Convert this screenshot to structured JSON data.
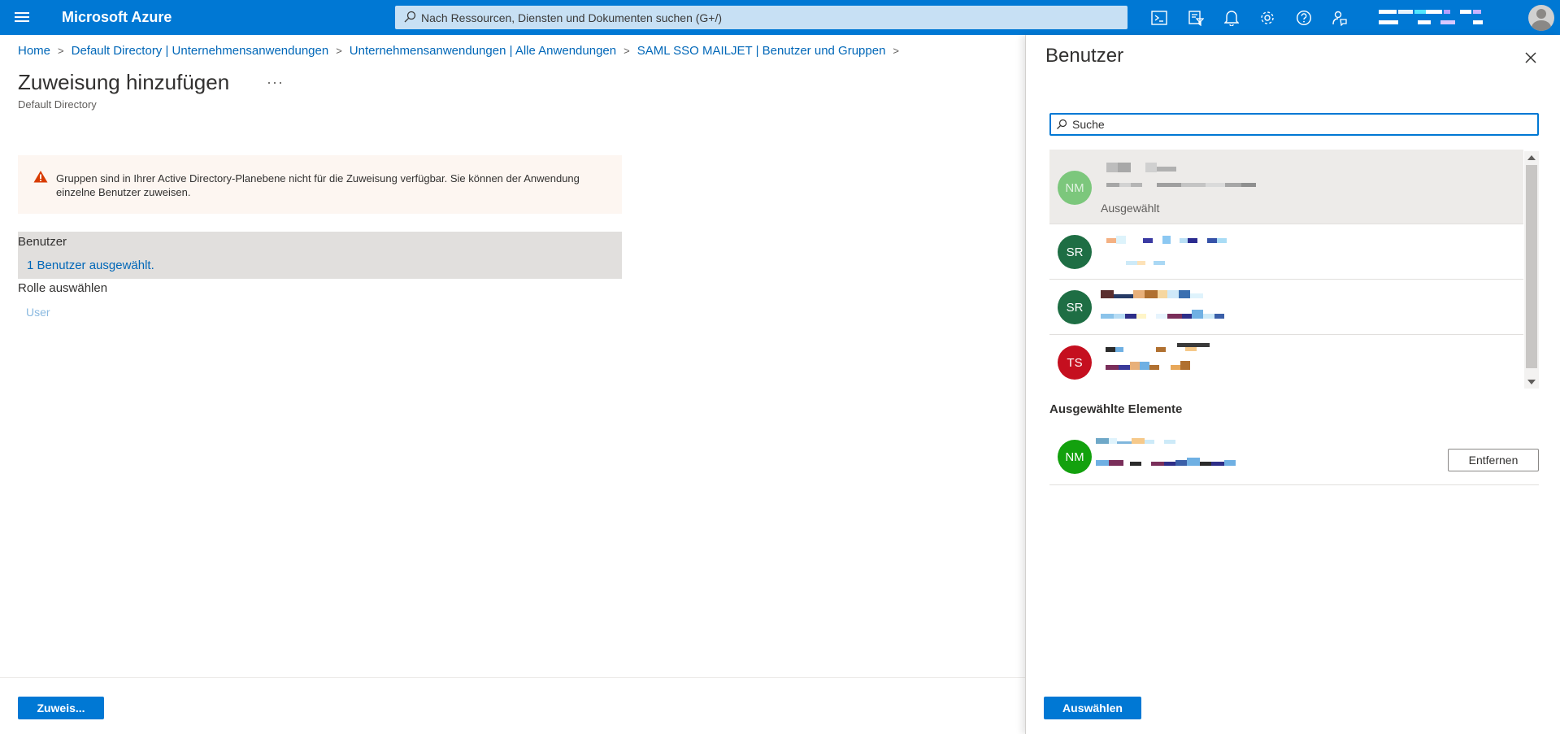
{
  "header": {
    "brand": "Microsoft Azure",
    "search_placeholder": "Nach Ressourcen, Diensten und Dokumenten suchen (G+/)",
    "icons": [
      "cloud-shell-icon",
      "directory-filter-icon",
      "notifications-icon",
      "settings-icon",
      "help-icon",
      "feedback-icon"
    ]
  },
  "breadcrumb": [
    "Home",
    "Default Directory | Unternehmensanwendungen",
    "Unternehmensanwendungen | Alle Anwendungen",
    "SAML SSO MAILJET | Benutzer und Gruppen"
  ],
  "page": {
    "title": "Zuweisung hinzufügen",
    "more": "···",
    "subtitle": "Default Directory",
    "warning": "Gruppen sind in Ihrer Active Directory-Planebene nicht für die Zuweisung verfügbar. Sie können der Anwendung einzelne Benutzer zuweisen.",
    "users_label": "Benutzer",
    "users_value": "1 Benutzer ausgewählt.",
    "role_label": "Rolle auswählen",
    "role_value": "User",
    "assign_button": "Zuweis..."
  },
  "panel": {
    "title": "Benutzer",
    "search_placeholder": "Suche",
    "users": [
      {
        "initials": "NM",
        "status": "Ausgewählt",
        "selected": true
      },
      {
        "initials": "SR",
        "status": "",
        "selected": false
      },
      {
        "initials": "SR",
        "status": "",
        "selected": false
      },
      {
        "initials": "TS",
        "status": "",
        "selected": false
      }
    ],
    "selected_heading": "Ausgewählte Elemente",
    "selected_item": {
      "initials": "NM"
    },
    "remove_button": "Entfernen",
    "select_button": "Auswählen"
  },
  "colors": {
    "accent": "#0078d4",
    "avatar_nm_faded": "#7cc77c",
    "avatar_sr": "#1e6e44",
    "avatar_ts": "#c50f1f",
    "avatar_nm": "#13a10e"
  }
}
